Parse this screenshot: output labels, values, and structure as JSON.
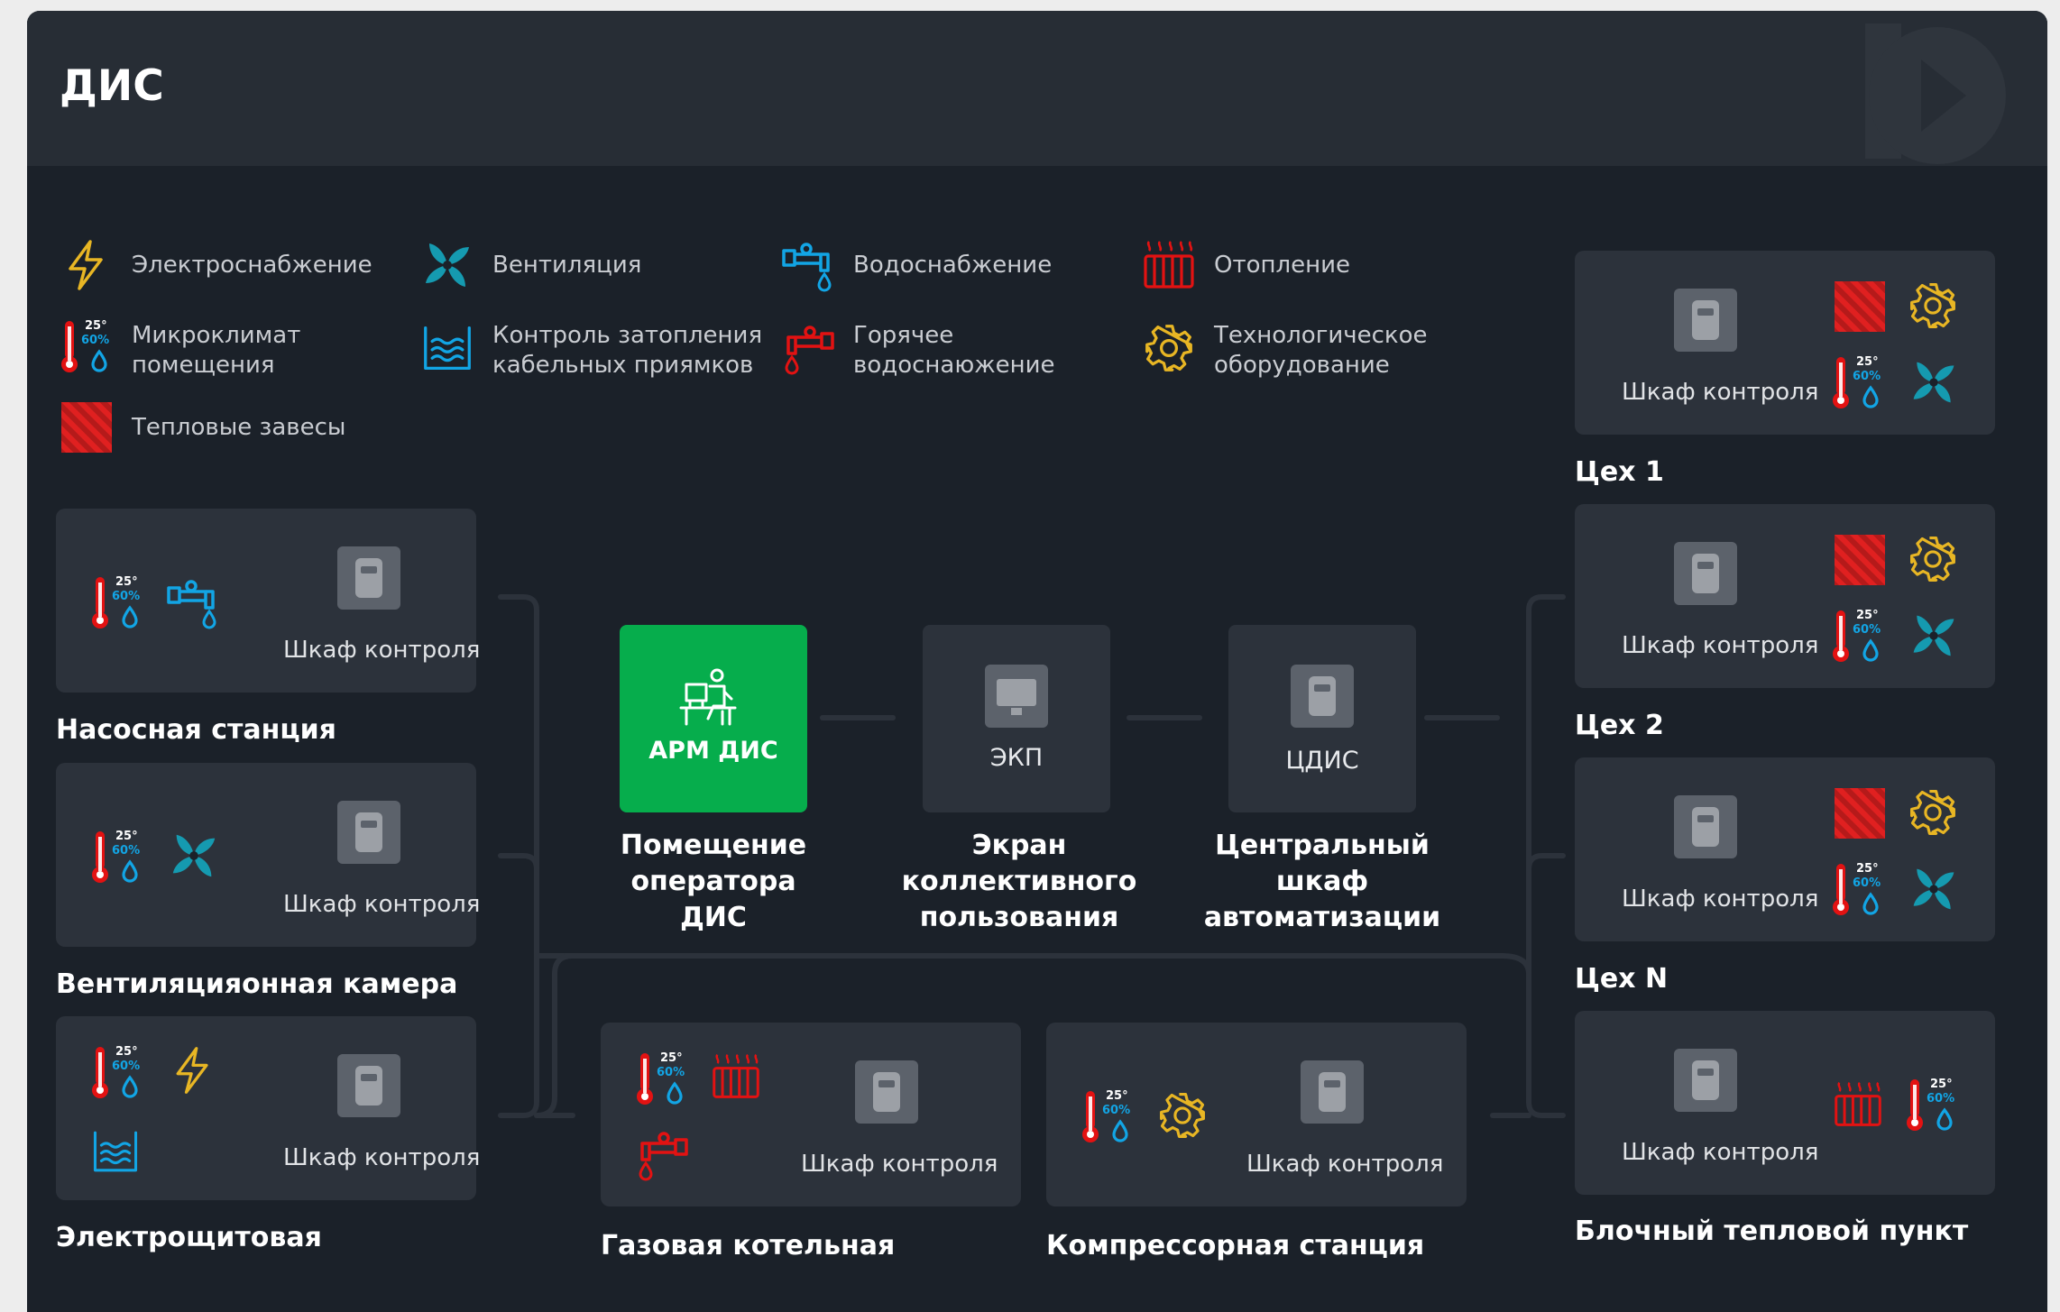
{
  "header": {
    "title": "ДИС"
  },
  "legend": [
    {
      "icon": "lightning-icon",
      "label": "Электроснабжение"
    },
    {
      "icon": "fan-icon",
      "label": "Вентиляция"
    },
    {
      "icon": "water-tap-icon",
      "label": "Водоснабжение"
    },
    {
      "icon": "radiator-icon",
      "label": "Отопление"
    },
    {
      "icon": "microclimate-icon",
      "label": "Микроклимат помещения"
    },
    {
      "icon": "flood-control-icon",
      "label": "Контроль затопления кабельных приямков"
    },
    {
      "icon": "hot-water-tap-icon",
      "label": "Горячее водоснаюжение"
    },
    {
      "icon": "gear-icon",
      "label": "Технологическое оборудование"
    },
    {
      "icon": "heat-curtain-icon",
      "label": "Тепловые завесы"
    }
  ],
  "microclimate": {
    "temp": "25°",
    "humidity": "60%"
  },
  "cabinet_label": "Шкаф контроля",
  "left_stations": [
    {
      "caption": "Насосная станция",
      "icons": [
        "microclimate-icon",
        "water-tap-icon"
      ]
    },
    {
      "caption": "Вентиляцияонная камера",
      "icons": [
        "microclimate-icon",
        "fan-icon"
      ]
    },
    {
      "caption": "Электрощитовая",
      "icons": [
        "microclimate-icon",
        "lightning-icon",
        "flood-control-icon"
      ]
    }
  ],
  "right_stations": [
    {
      "caption": "Цех 1",
      "icons": [
        "heat-curtain-icon",
        "gear-icon",
        "microclimate-icon",
        "fan-icon"
      ]
    },
    {
      "caption": "Цех 2",
      "icons": [
        "heat-curtain-icon",
        "gear-icon",
        "microclimate-icon",
        "fan-icon"
      ]
    },
    {
      "caption": "Цех N",
      "icons": [
        "heat-curtain-icon",
        "gear-icon",
        "microclimate-icon",
        "fan-icon"
      ]
    },
    {
      "caption": "Блочный тепловой пункт",
      "icons": [
        "radiator-icon",
        "microclimate-icon"
      ]
    }
  ],
  "bottom_stations": [
    {
      "caption": "Газовая котельная",
      "icons": [
        "microclimate-icon",
        "radiator-icon",
        "hot-water-tap-icon"
      ]
    },
    {
      "caption": "Компрессорная станция",
      "icons": [
        "microclimate-icon",
        "gear-icon"
      ]
    }
  ],
  "center_nodes": [
    {
      "label": "АРМ ДИС",
      "caption": "Помещение оператора ДИС",
      "icon": "operator-icon",
      "color": "#06ad4c"
    },
    {
      "label": "ЭКП",
      "caption": "Экран коллективного пользования",
      "icon": "monitor-icon"
    },
    {
      "label": "ЦДИС",
      "caption": "Центральный шкаф автоматизации",
      "icon": "cabinet-icon"
    }
  ],
  "colors": {
    "yellow": "#e8b624",
    "teal": "#159ab0",
    "blue": "#12a5e5",
    "red": "#e31212",
    "gold": "#e8b624",
    "green": "#06ad4c"
  }
}
